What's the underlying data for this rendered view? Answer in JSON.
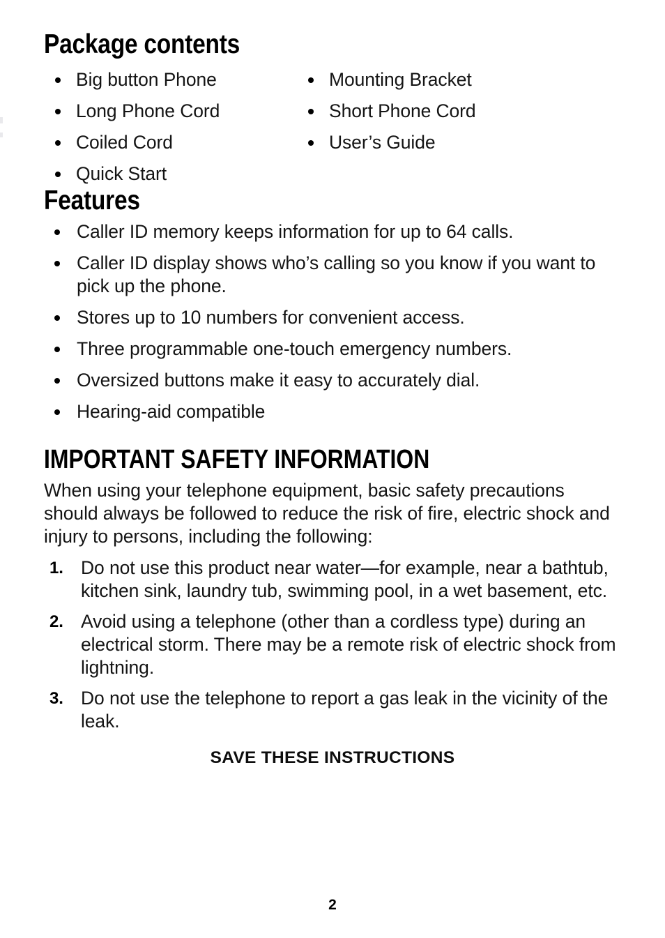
{
  "document": {
    "page_number": "2"
  },
  "sections": {
    "package_contents": {
      "heading": "Package contents",
      "column_left": [
        "Big button Phone",
        "Long Phone Cord",
        "Coiled Cord",
        "Quick Start"
      ],
      "column_right": [
        "Mounting Bracket",
        "Short Phone Cord",
        "User’s Guide"
      ]
    },
    "features": {
      "heading": "Features",
      "items": [
        "Caller ID memory keeps information for up to 64 calls.",
        "Caller ID display shows who’s calling so you know if you want to pick up the phone.",
        "Stores up to 10 numbers for convenient access.",
        "Three programmable one-touch emergency numbers.",
        "Oversized buttons make it easy to accurately dial.",
        "Hearing-aid compatible"
      ]
    },
    "safety": {
      "heading": "IMPORTANT SAFETY INFORMATION",
      "intro": "When using your telephone equipment, basic safety precautions should always be followed to reduce the risk of fire, electric shock and injury to persons, including the following:",
      "items": [
        {
          "number": "1.",
          "text": "Do not use this product near water—for example, near a bathtub, kitchen sink, laundry tub, swimming pool, in a wet basement, etc."
        },
        {
          "number": "2.",
          "text": "Avoid using a telephone (other than a cordless type) during an electrical storm. There may be a remote risk of electric shock from lightning."
        },
        {
          "number": "3.",
          "text": "Do not use the telephone to report a gas leak in the vicinity of the leak."
        }
      ],
      "footer_note": "SAVE THESE INSTRUCTIONS"
    }
  },
  "colors": {
    "text": "#141414",
    "heading": "#000000",
    "background": "#ffffff"
  }
}
